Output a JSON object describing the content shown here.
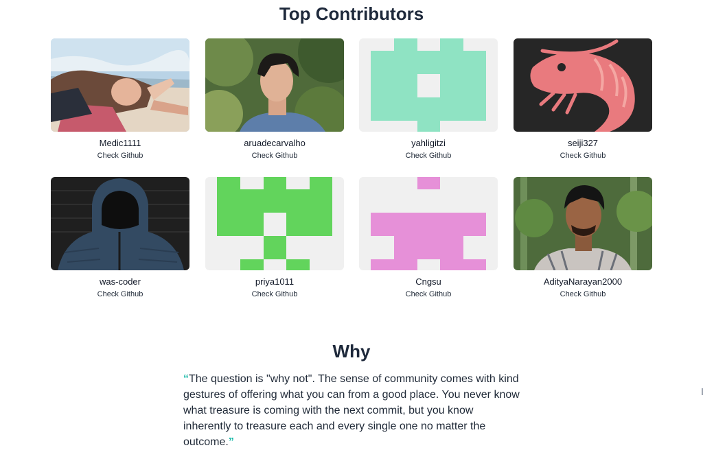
{
  "contributors_section": {
    "title": "Top Contributors",
    "link_label": "Check Github",
    "contributors": [
      {
        "username": "Medic1111"
      },
      {
        "username": "aruadecarvalho"
      },
      {
        "username": "yahligitzi"
      },
      {
        "username": "seiji327"
      },
      {
        "username": "was-coder"
      },
      {
        "username": "priya1011"
      },
      {
        "username": "Cngsu"
      },
      {
        "username": "AdityaNarayan2000"
      }
    ]
  },
  "why_section": {
    "title": "Why",
    "open_quote": "“",
    "close_quote": "”",
    "quote": "The question is \"why not\". The sense of community comes with kind gestures of offering what you can from a good place. You never know what treasure is coming with the next commit, but you know inherently to treasure each and every single one no matter the outcome."
  },
  "colors": {
    "identicon_green_light": "#8fe3c3",
    "identicon_green": "#62d45c",
    "identicon_pink": "#e690d8",
    "identicon_bg": "#f0f0f0",
    "quote_accent": "#14b8a6"
  },
  "icons": {
    "seiji327": "shrimp-icon"
  }
}
